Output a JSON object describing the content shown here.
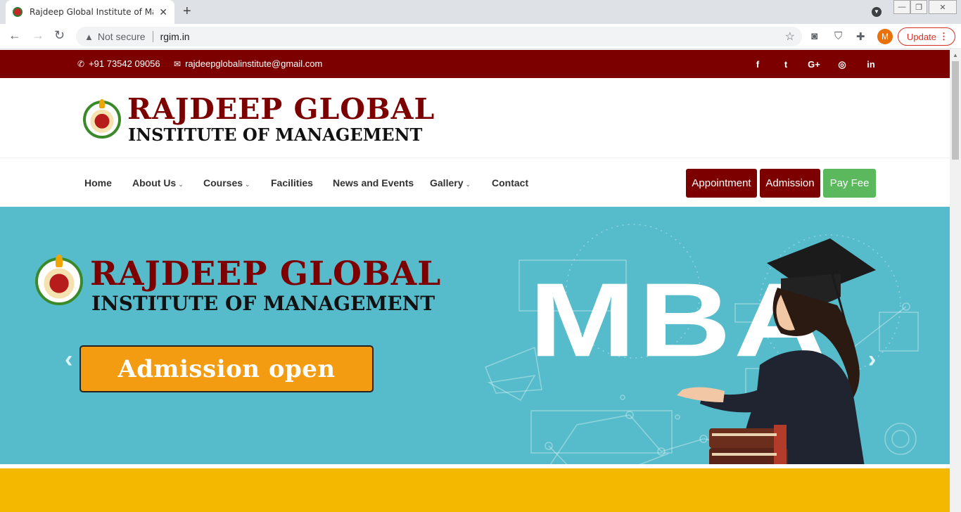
{
  "browser": {
    "tab_title": "Rajdeep Global Institute of Mana",
    "tab_close": "✕",
    "new_tab": "+",
    "security": "Not secure",
    "url": "rgim.in",
    "avatar_letter": "M",
    "update_label": "Update",
    "update_dots": "⋮"
  },
  "topbar": {
    "phone": "+91 73542 09056",
    "email": "rajdeepglobalinstitute@gmail.com",
    "social": [
      "f",
      "t",
      "G+",
      "◎",
      "in"
    ]
  },
  "brand": {
    "line1": "RAJDEEP GLOBAL",
    "line2": "INSTITUTE OF MANAGEMENT"
  },
  "nav": {
    "items": [
      {
        "label": "Home",
        "dropdown": false
      },
      {
        "label": "About Us",
        "dropdown": true
      },
      {
        "label": "Courses",
        "dropdown": true
      },
      {
        "label": "Facilities",
        "dropdown": false
      },
      {
        "label": "News and Events",
        "dropdown": false
      },
      {
        "label": "Gallery",
        "dropdown": true
      },
      {
        "label": "Contact",
        "dropdown": false
      }
    ],
    "caret": "⌄",
    "buttons": [
      {
        "label": "Appointment",
        "color": "#7d0000"
      },
      {
        "label": "Admission",
        "color": "#7d0000"
      },
      {
        "label": "Pay Fee",
        "color": "#5cb85c"
      }
    ]
  },
  "hero": {
    "brand_line1": "RAJDEEP GLOBAL",
    "brand_line2": "INSTITUTE OF MANAGEMENT",
    "admission": "Admission open",
    "mba": "MBA",
    "prev": "‹",
    "next": "›"
  },
  "colors": {
    "maroon": "#7d0000",
    "teal": "#56bccb",
    "orange": "#f39c12",
    "green": "#5cb85c",
    "yellow": "#f5b800"
  }
}
